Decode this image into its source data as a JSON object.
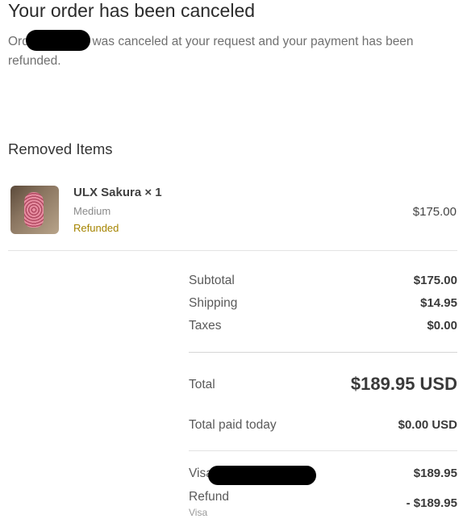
{
  "page": {
    "title": "Your order has been canceled",
    "message_start": "Orde",
    "message_end": "was canceled at your request and your payment has been refunded."
  },
  "removed_items": {
    "heading": "Removed Items",
    "items": [
      {
        "name": "ULX Sakura × 1",
        "variant": "Medium",
        "status": "Refunded",
        "price": "$175.00"
      }
    ]
  },
  "summary": {
    "subtotal_label": "Subtotal",
    "subtotal_value": "$175.00",
    "shipping_label": "Shipping",
    "shipping_value": "$14.95",
    "taxes_label": "Taxes",
    "taxes_value": "$0.00",
    "total_label": "Total",
    "total_value": "$189.95 USD",
    "paid_label": "Total paid today",
    "paid_value": "$0.00 USD",
    "visa_label": "Visa",
    "visa_value": "$189.95",
    "refund_label": "Refund",
    "refund_sub": "Visa",
    "refund_value": "- $189.95"
  },
  "colors": {
    "refunded_status": "#a58400",
    "text_primary": "#333333",
    "text_muted": "#707070"
  }
}
